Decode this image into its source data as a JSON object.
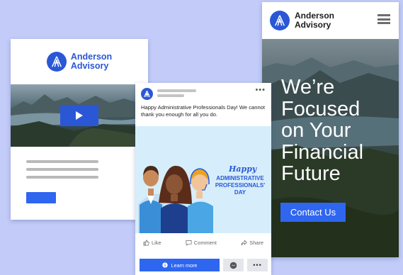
{
  "brand": {
    "name_line1": "Anderson",
    "name_line2": "Advisory",
    "logo_icon": "a-monogram-logo",
    "color": "#2a57d6"
  },
  "email_card": {
    "hero_icon": "play-icon"
  },
  "social_post": {
    "text": "Happy Administrative Professionals Day! We cannot thank you enough for all you do.",
    "image": {
      "happy": "Happy",
      "title_line1": "ADMINISTRATIVE",
      "title_line2": "PROFESSIONALS' DAY"
    },
    "actions": {
      "like": "Like",
      "comment": "Comment",
      "share": "Share"
    },
    "cta_label": "Learn more"
  },
  "landing": {
    "headline_lines": [
      "We’re",
      "Focused",
      "on Your",
      "Financial",
      "Future"
    ],
    "cta_label": "Contact Us"
  },
  "colors": {
    "page_background": "#c3ccf8",
    "accent": "#2f66f0"
  }
}
